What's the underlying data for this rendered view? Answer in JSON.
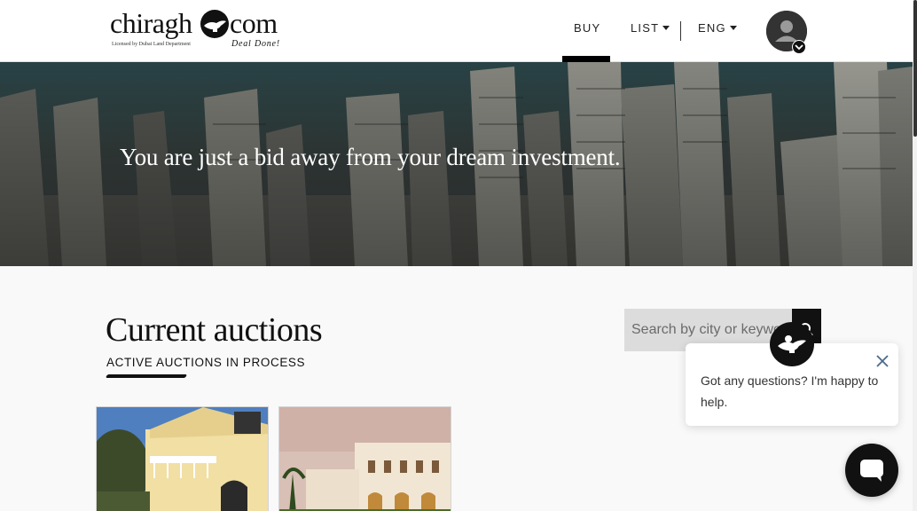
{
  "header": {
    "logo": {
      "word_left": "chiragh",
      "word_right": "com",
      "license": "Licensed by Dubai Land Department",
      "tagline": "Deal Done!"
    },
    "nav": {
      "buy": "BUY",
      "list": "LIST",
      "language": "ENG"
    },
    "avatar_icon": "user-icon"
  },
  "hero": {
    "headline": "You are just a bid away from your dream investment."
  },
  "main": {
    "title": "Current auctions",
    "subtitle": "ACTIVE AUCTIONS IN PROCESS",
    "search": {
      "placeholder": "Search by city or keyword",
      "button_icon": "search-icon"
    }
  },
  "chat": {
    "message": "Got any questions? I'm happy to help.",
    "close_icon": "close-icon",
    "launcher_icon": "chat-icon"
  },
  "colors": {
    "brand": "#111111",
    "search_bg": "#dcdcdc",
    "chat_close": "#4a6a8a"
  }
}
